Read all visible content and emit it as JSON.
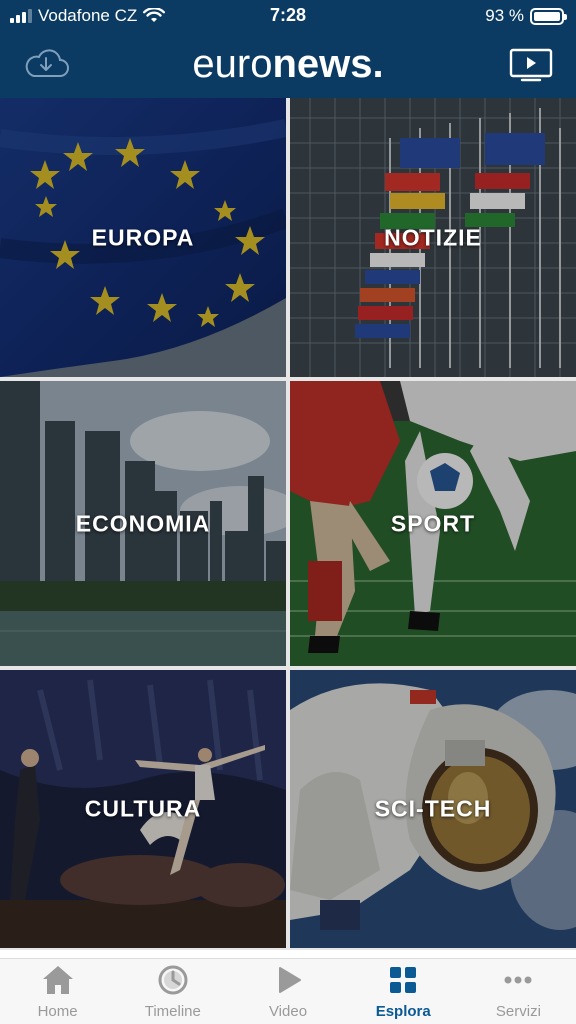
{
  "status_bar": {
    "carrier": "Vodafone CZ",
    "time": "7:28",
    "battery": "93 %"
  },
  "header": {
    "logo_part1": "euro",
    "logo_part2": "news.",
    "download_icon": "cloud-download-icon",
    "tv_icon": "tv-play-icon"
  },
  "categories": [
    {
      "label": "EUROPA",
      "image": "eu-flag"
    },
    {
      "label": "NOTIZIE",
      "image": "flags-parliament"
    },
    {
      "label": "ECONOMIA",
      "image": "city-skyline"
    },
    {
      "label": "SPORT",
      "image": "football-players"
    },
    {
      "label": "CULTURA",
      "image": "ballet-stage"
    },
    {
      "label": "SCI-TECH",
      "image": "astronaut"
    }
  ],
  "tabs": [
    {
      "label": "Home",
      "icon": "home-icon",
      "active": false
    },
    {
      "label": "Timeline",
      "icon": "clock-icon",
      "active": false
    },
    {
      "label": "Video",
      "icon": "play-icon",
      "active": false
    },
    {
      "label": "Esplora",
      "icon": "grid-icon",
      "active": true
    },
    {
      "label": "Servizi",
      "icon": "more-dots-icon",
      "active": false
    }
  ],
  "colors": {
    "brand_bar": "#0b3b62",
    "tab_active": "#0b5a94",
    "tab_inactive": "#9a9a9a"
  }
}
